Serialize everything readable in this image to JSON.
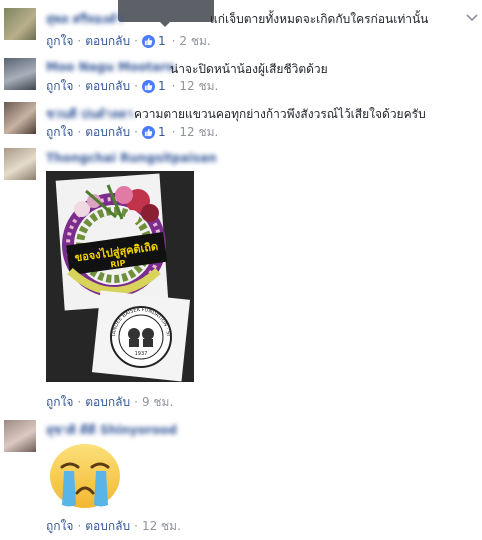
{
  "actions": {
    "like": "ถูกใจ",
    "reply": "ตอบกลับ",
    "separator": "·"
  },
  "comments": [
    {
      "name": "สุพล ศรีทองคำ",
      "text": "แก่เจ็บตายทั้งหมดจะเกิดกับใครก่อนเท่านั้น",
      "likes": "1",
      "time": "2 ชม."
    },
    {
      "name": "Moo Nagu Mootaro",
      "text": "น่าจะปิดหน้าน้องผู้เสียชีวิตด้วย",
      "likes": "1",
      "time": "12 ชม."
    },
    {
      "name": "ชวนดี ปนดำลดา",
      "text": "ความตายแขวนคอทุกย่างก้าวพึงสังวรณ์ไว้เสียใจด้วยครับ",
      "likes": "1",
      "time": "12 ชม."
    },
    {
      "name": "Thongchai Rungsitpaisan",
      "time": "9 ชม.",
      "photo": {
        "banner": "ขอจงไปสู่สุคติเถิด",
        "rip": "RIP",
        "stamp_arc": "TANDEE BAISEK FUNDATION · SINCE 1937",
        "stamp_year": "1937"
      }
    },
    {
      "name": "สุชาติ ดีดี Shinyorood",
      "time": "12 ชม.",
      "emoji": "crying-face"
    }
  ],
  "colors": {
    "link": "#365899",
    "meta": "#90949c",
    "like_badge": "#4a7aff",
    "text": "#1d2129"
  }
}
